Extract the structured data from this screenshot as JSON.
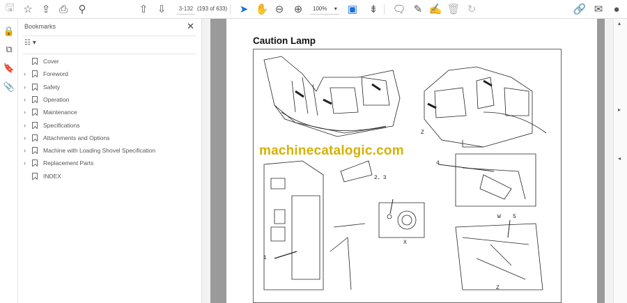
{
  "toolbar": {
    "page_label": "3-132",
    "page_count": "(193 of 633)",
    "zoom": "100%",
    "icons": [
      "save-icon",
      "star-icon",
      "cloud-upload-icon",
      "print-icon",
      "search-icon",
      "prev-page-icon",
      "next-page-icon",
      "select-cursor-icon",
      "hand-icon",
      "zoom-out-icon",
      "zoom-in-icon",
      "fit-page-icon",
      "scroll-mode-icon",
      "comment-icon",
      "pen-icon",
      "sign-icon",
      "delete-icon",
      "rotate-icon",
      "share-link-icon",
      "email-icon",
      "account-icon"
    ]
  },
  "rail": {
    "icons": [
      "lock-icon",
      "pages-icon",
      "bookmark-icon",
      "attachment-icon"
    ]
  },
  "bookmarks": {
    "title": "Bookmarks",
    "items": [
      {
        "label": "Cover",
        "expandable": false
      },
      {
        "label": "Foreword",
        "expandable": true
      },
      {
        "label": "Safety",
        "expandable": true
      },
      {
        "label": "Operation",
        "expandable": true
      },
      {
        "label": "Maintenance",
        "expandable": true
      },
      {
        "label": "Specifications",
        "expandable": true
      },
      {
        "label": "Attachments and Options",
        "expandable": true
      },
      {
        "label": "Machine with Loading Shovel Specification",
        "expandable": true
      },
      {
        "label": "Replacement Parts",
        "expandable": true
      },
      {
        "label": "INDEX",
        "expandable": false
      }
    ]
  },
  "document": {
    "title": "Caution Lamp",
    "watermark": "machinecatalogic.com",
    "callouts": {
      "z_top": "Z",
      "c23": "2．3",
      "x": "X",
      "c4": "4",
      "w": "W",
      "c5": "5",
      "c1": "1",
      "z_bottom": "Z"
    }
  }
}
